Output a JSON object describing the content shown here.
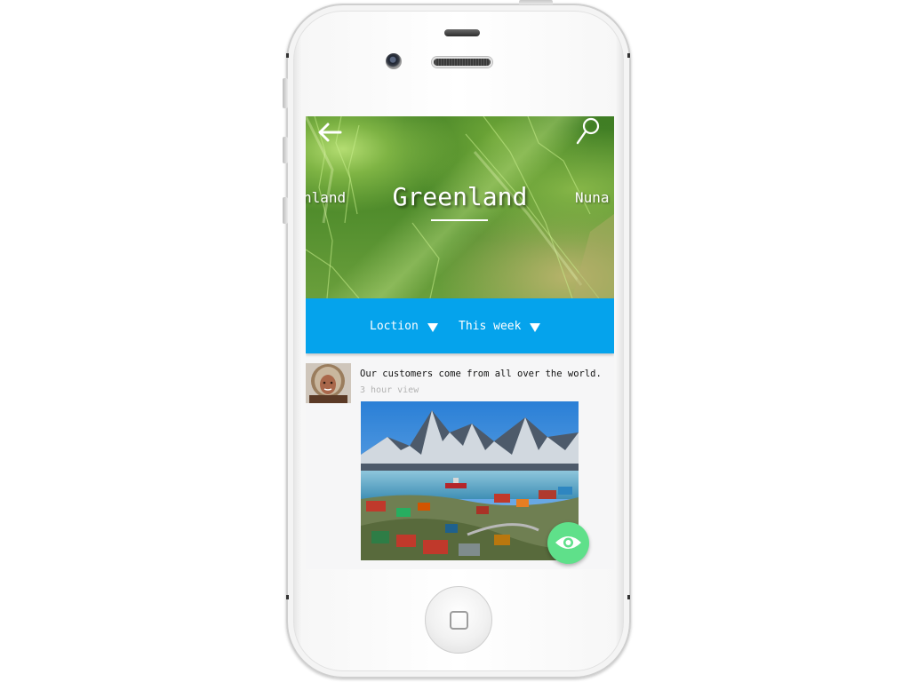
{
  "header": {
    "title": "Greenland",
    "carousel_left": "nland",
    "carousel_right": "Nuna"
  },
  "filters": {
    "location_label": "Loction",
    "period_label": "This week"
  },
  "post": {
    "text": "Our customers come from all over the world.",
    "meta": "3 hour view"
  },
  "icons": {
    "back": "arrow-left-icon",
    "search": "search-icon",
    "dropdown": "triangle-down-icon",
    "fab": "eye-icon",
    "home": "home-button-square"
  },
  "colors": {
    "filter_bar": "#05a3ec",
    "fab": "#5fe08a",
    "hero_green": "#4d8a2a"
  }
}
